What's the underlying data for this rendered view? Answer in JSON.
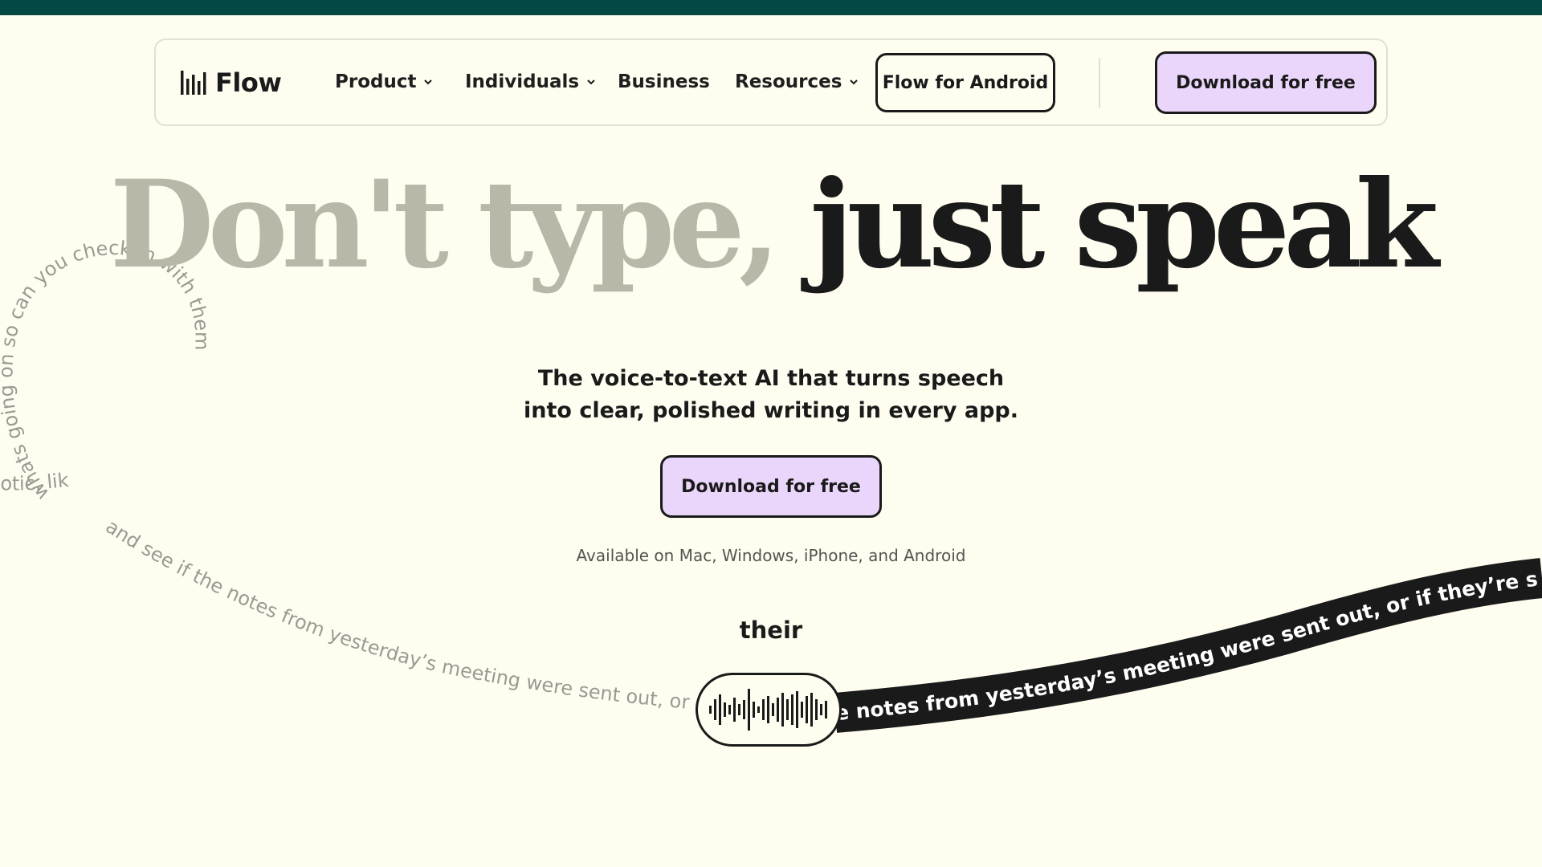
{
  "brand": {
    "name": "Flow",
    "accent": "#034842",
    "button_color": "#ebd6fb",
    "background": "#fefdf0"
  },
  "nav": {
    "logo_icon": "waveform-bars-icon",
    "items": [
      {
        "label": "Product",
        "has_dropdown": true
      },
      {
        "label": "Individuals",
        "has_dropdown": true
      },
      {
        "label": "Business",
        "has_dropdown": false
      },
      {
        "label": "Resources",
        "has_dropdown": true
      }
    ],
    "android_button": "Flow for Android",
    "download_button": "Download for free"
  },
  "hero": {
    "title_light": "Don't type,",
    "title_dark": "just speak",
    "subtitle_line1": "The voice-to-text AI that turns speech",
    "subtitle_line2": "into clear, polished writing in every app.",
    "cta": "Download for free",
    "availability": "Available on Mac, Windows, iPhone, and Android"
  },
  "transcript": {
    "current_word": "their",
    "spoken_text": "whats going on so can you check in with them and see if the notes from yesterday's meeting were sent out, or if they're still waiting on",
    "loop_text_1": "whats going on so can you check in with them",
    "fragment_left": "otic, like nobody really knows",
    "trail_text": "and see if the notes from yesterday’s meeting were sent out, or",
    "ribbon_text": "e notes from yesterday’s meeting were sent out, or if they’re still waiting"
  }
}
